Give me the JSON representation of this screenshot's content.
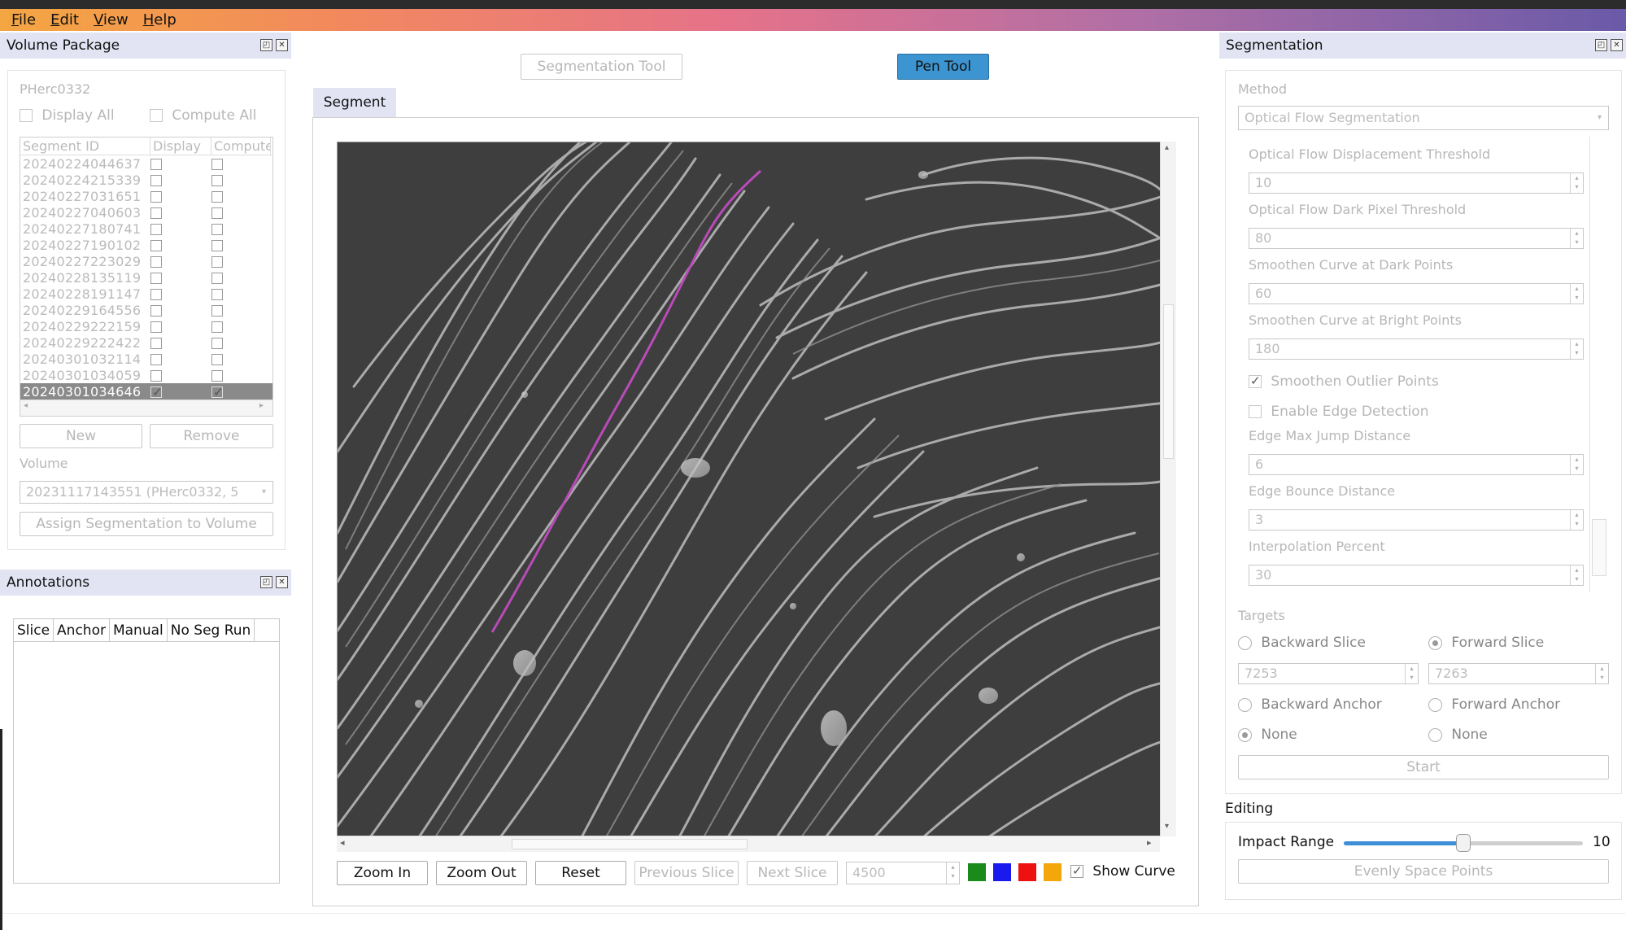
{
  "menu": [
    "File",
    "Edit",
    "View",
    "Help"
  ],
  "volume_package": {
    "title": "Volume Package",
    "name": "PHerc0332",
    "display_all": "Display All",
    "compute_all": "Compute All",
    "columns": [
      "Segment ID",
      "Display",
      "Compute"
    ],
    "segments": [
      {
        "id": "20240224044637",
        "display": false,
        "compute": false
      },
      {
        "id": "20240224215339",
        "display": false,
        "compute": false
      },
      {
        "id": "20240227031651",
        "display": false,
        "compute": false
      },
      {
        "id": "20240227040603",
        "display": false,
        "compute": false
      },
      {
        "id": "20240227180741",
        "display": false,
        "compute": false
      },
      {
        "id": "20240227190102",
        "display": false,
        "compute": false
      },
      {
        "id": "20240227223029",
        "display": false,
        "compute": false
      },
      {
        "id": "20240228135119",
        "display": false,
        "compute": false
      },
      {
        "id": "20240228191147",
        "display": false,
        "compute": false
      },
      {
        "id": "20240229164556",
        "display": false,
        "compute": false
      },
      {
        "id": "20240229222159",
        "display": false,
        "compute": false
      },
      {
        "id": "20240229222422",
        "display": false,
        "compute": false
      },
      {
        "id": "20240301032114",
        "display": false,
        "compute": false
      },
      {
        "id": "20240301034059",
        "display": false,
        "compute": false
      },
      {
        "id": "20240301034646",
        "display": true,
        "compute": true,
        "selected": true
      }
    ],
    "new_button": "New",
    "remove_button": "Remove",
    "volume_label": "Volume",
    "volume_value": "20231117143551 (PHerc0332, 5",
    "assign_button": "Assign Segmentation to Volume"
  },
  "annotations": {
    "title": "Annotations",
    "columns": [
      "Slice",
      "Anchor",
      "Manual",
      "No Seg Run"
    ]
  },
  "center": {
    "segmentation_tool_button": "Segmentation Tool",
    "pen_tool_button": "Pen Tool",
    "tab": "Segment",
    "zoom_in": "Zoom In",
    "zoom_out": "Zoom Out",
    "reset": "Reset",
    "previous_slice": "Previous Slice",
    "next_slice": "Next Slice",
    "slice_value": "4500",
    "swatches": [
      "#1a8a1a",
      "#1a1aee",
      "#ee1111",
      "#f4a70a"
    ],
    "show_curve_label": "Show Curve",
    "show_curve_checked": true,
    "curve_color": "#b84bb8"
  },
  "segmentation": {
    "title": "Segmentation",
    "method_label": "Method",
    "method_value": "Optical Flow Segmentation",
    "params": [
      {
        "label": "Optical Flow Displacement Threshold",
        "value": "10"
      },
      {
        "label": "Optical Flow Dark Pixel Threshold",
        "value": "80"
      },
      {
        "label": "Smoothen Curve at Dark Points",
        "value": "60"
      },
      {
        "label": "Smoothen Curve at Bright Points",
        "value": "180"
      }
    ],
    "smoothen_outlier": "Smoothen Outlier Points",
    "smoothen_outlier_checked": true,
    "edge_detection": "Enable Edge Detection",
    "edge_detection_checked": false,
    "params2": [
      {
        "label": "Edge Max Jump Distance",
        "value": "6"
      },
      {
        "label": "Edge Bounce Distance",
        "value": "3"
      },
      {
        "label": "Interpolation Percent",
        "value": "30"
      }
    ],
    "targets_label": "Targets",
    "backward_slice": "Backward Slice",
    "forward_slice": "Forward Slice",
    "backward_slice_value": "7253",
    "forward_slice_value": "7263",
    "backward_anchor": "Backward Anchor",
    "forward_anchor": "Forward Anchor",
    "none_left": "None",
    "none_right": "None",
    "start_button": "Start"
  },
  "editing": {
    "title": "Editing",
    "impact_range_label": "Impact Range",
    "impact_range_value": "10",
    "impact_range_fraction": 0.5,
    "evenly_space_button": "Evenly Space Points"
  }
}
